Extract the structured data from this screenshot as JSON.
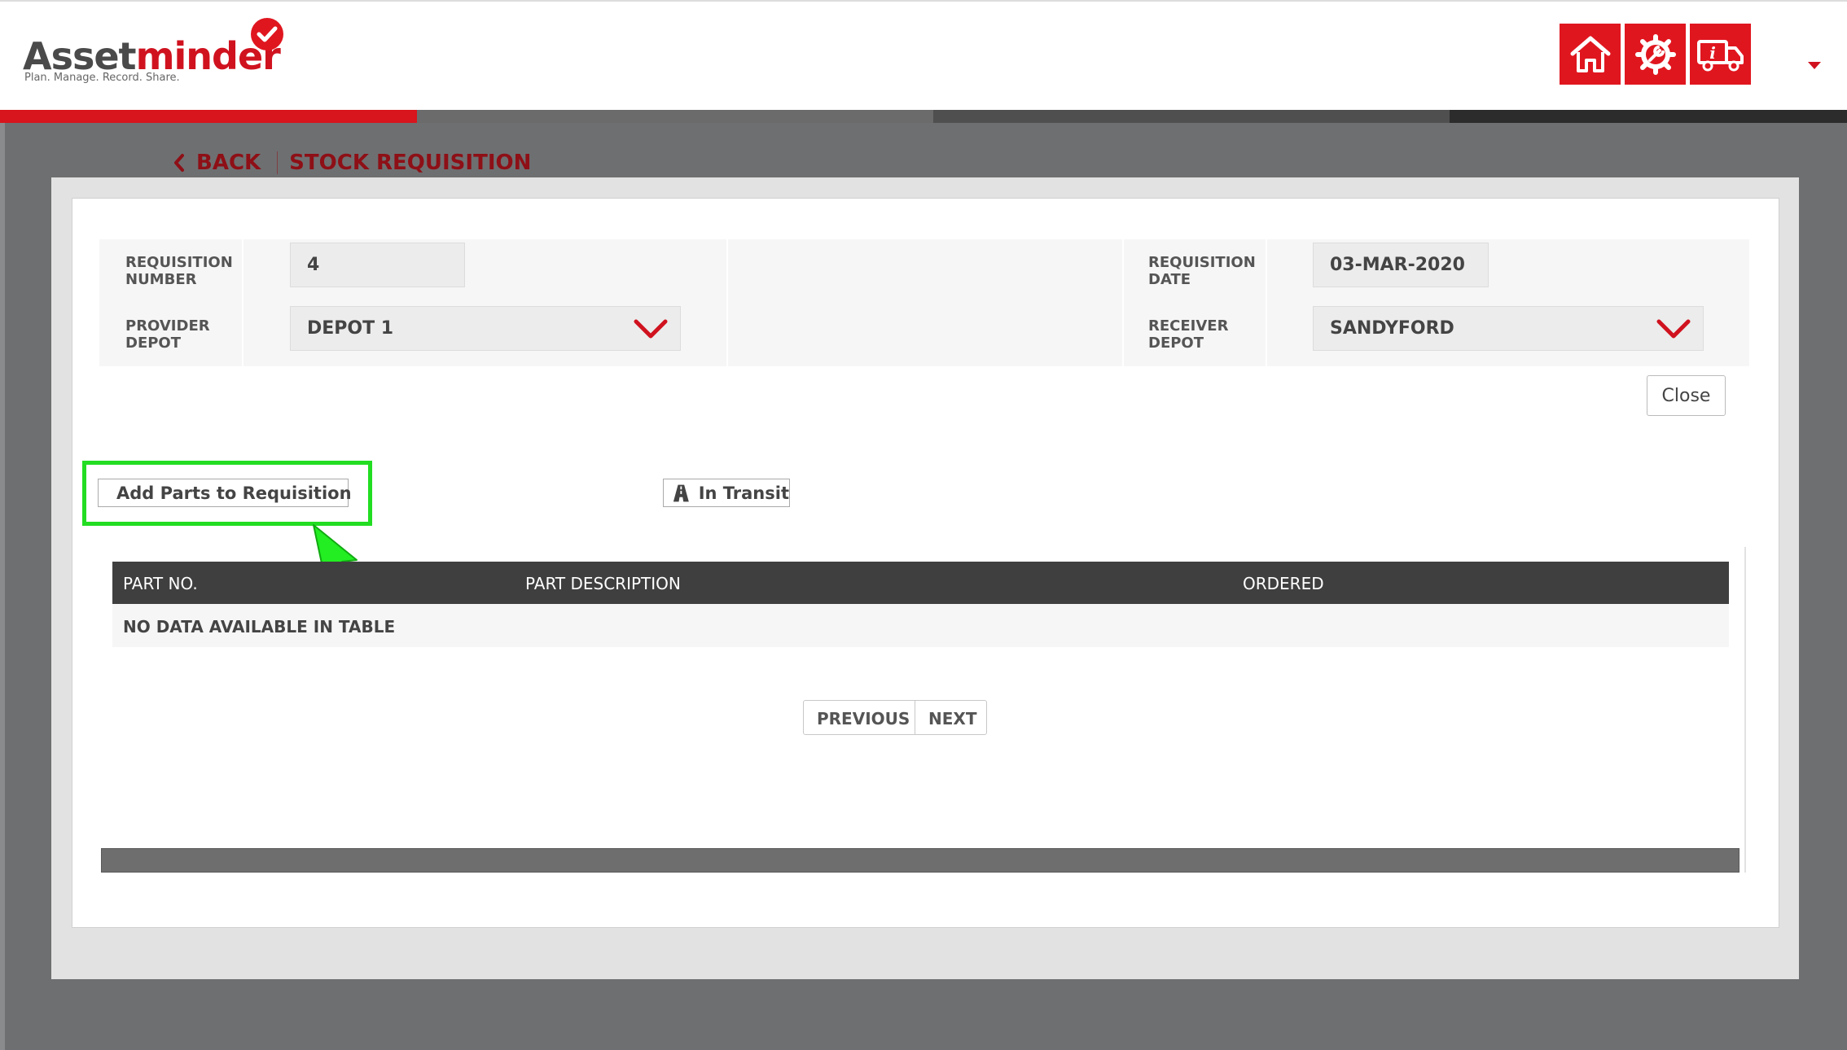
{
  "brand": {
    "name_part1": "Asset",
    "name_part2": "minder",
    "tagline": "Plan. Manage. Record. Share.",
    "accent_color": "#e0161f"
  },
  "header": {
    "icons": [
      "home-icon",
      "gear-wrench-icon",
      "truck-info-icon"
    ]
  },
  "breadcrumb": {
    "back_label": "BACK",
    "title": "STOCK REQUISITION"
  },
  "form": {
    "requisition_number_label": "REQUISITION NUMBER",
    "requisition_number_value": "4",
    "requisition_date_label": "REQUISITION DATE",
    "requisition_date_value": "03-MAR-2020",
    "provider_depot_label": "PROVIDER DEPOT",
    "provider_depot_value": "DEPOT 1",
    "receiver_depot_label": "RECEIVER DEPOT",
    "receiver_depot_value": "SANDYFORD"
  },
  "actions": {
    "close_label": "Close",
    "add_parts_label": "Add Parts to Requisition",
    "in_transit_label": "In Transit"
  },
  "table": {
    "columns": [
      "PART NO.",
      "PART DESCRIPTION",
      "ORDERED"
    ],
    "empty_message": "NO DATA AVAILABLE IN TABLE"
  },
  "pagination": {
    "previous_label": "PREVIOUS",
    "next_label": "NEXT"
  }
}
